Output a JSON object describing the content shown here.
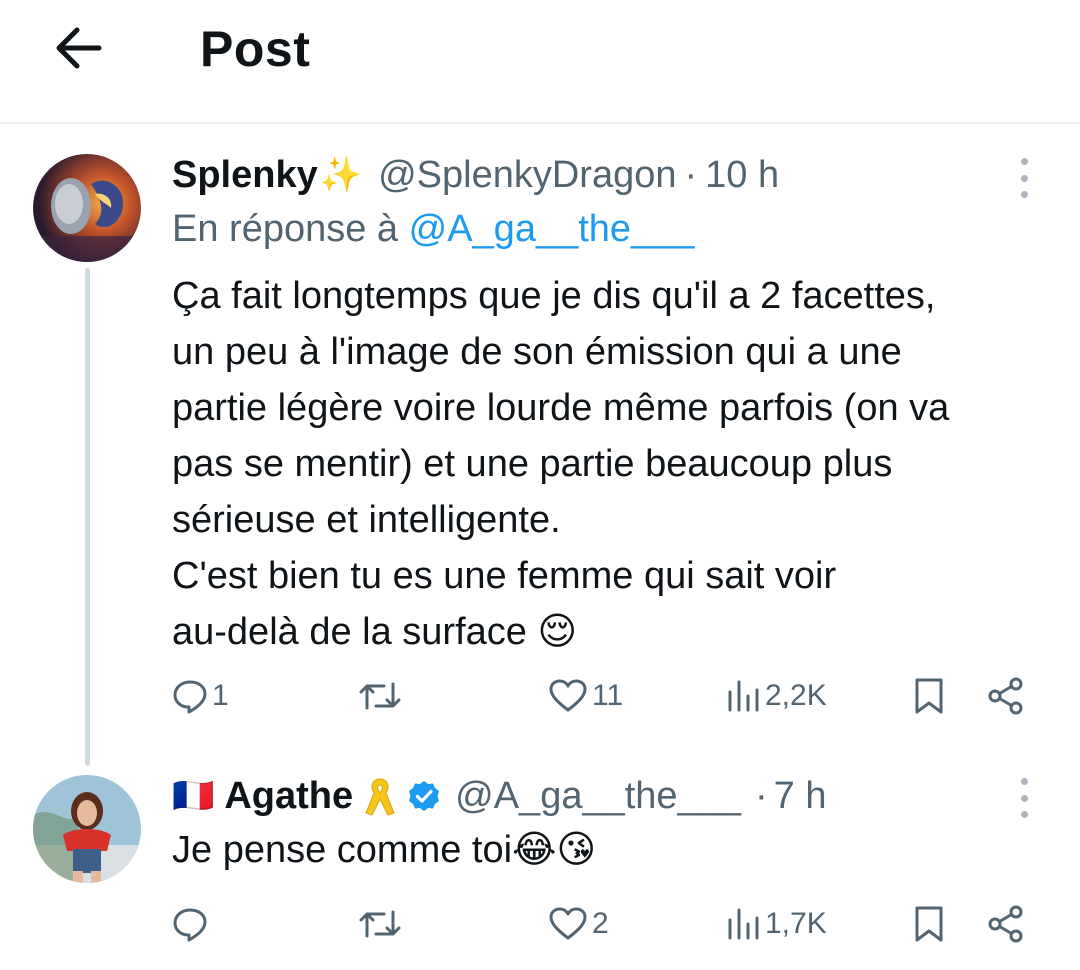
{
  "header": {
    "title": "Post",
    "back_icon": "arrow-left-icon"
  },
  "tweets": [
    {
      "display_name": "Splenky",
      "name_emoji": "✨",
      "handle": "@SplenkyDragon",
      "separator": "·",
      "time": "10 h",
      "reply_prefix": "En réponse à",
      "reply_handle": "@A_ga__the___",
      "text_lines": [
        "Ça fait longtemps que je dis qu'il a 2 facettes,",
        "un peu à l'image de son émission qui a une",
        "partie légère voire lourde même parfois (on va",
        "pas se mentir) et une partie beaucoup plus",
        "sérieuse et intelligente.",
        "C'est bien tu es une femme qui sait voir",
        "au-delà de la surface 😌"
      ],
      "stats": {
        "replies": "1",
        "retweets": "",
        "likes": "11",
        "views": "2,2K"
      }
    },
    {
      "flag": "🇫🇷",
      "display_name": "Agathe",
      "name_emoji": "🎗️",
      "verified": true,
      "handle": "@A_ga__the___",
      "separator": "·",
      "time": "7 h",
      "text_lines": [
        "Je pense comme toi😂😘"
      ],
      "stats": {
        "replies": "",
        "retweets": "",
        "likes": "2",
        "views": "1,7K"
      }
    }
  ],
  "colors": {
    "accent": "#1d9bf0",
    "muted": "#536471",
    "text": "#0f1419",
    "thread_line": "#cfd9de",
    "ribbon": "#f5c518"
  }
}
